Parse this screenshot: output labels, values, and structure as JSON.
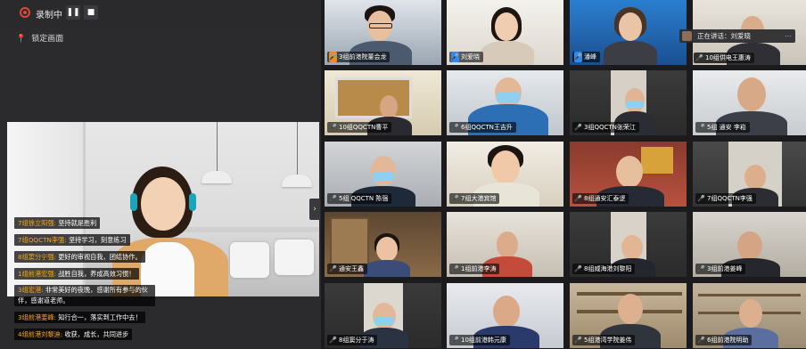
{
  "toolbar": {
    "recording_label": "录制中",
    "pause_icon": "pause-icon",
    "stop_icon": "stop-icon"
  },
  "lock_label": "锁定画面",
  "speaking_label": "正在讲话：刘爱晓",
  "chat_messages": [
    {
      "name": "7组徐立阳强:",
      "text": "坚持就是胜利"
    },
    {
      "name": "7组QQCTN李强:",
      "text": "坚持学习，刻意练习"
    },
    {
      "name": "8组窦分宁强:",
      "text": "更好的审视自我，团结协作。"
    },
    {
      "name": "1组前港宏强:",
      "text": "战胜自我，养成高效习惯！"
    },
    {
      "name": "3组宏港:",
      "text": "非常美好的夜晚，感谢所有参与的伙伴，感谢道老师。"
    },
    {
      "name": "3组前港姜峰:",
      "text": "知行合一，落实到工作中去！"
    },
    {
      "name": "4组前港刘黎迪:",
      "text": "收获，成长，共同进步"
    }
  ],
  "participants": [
    {
      "name": "3组前港院董会龙",
      "mic": "orange"
    },
    {
      "name": "刘爱晓",
      "mic": "blue"
    },
    {
      "name": "潘峰",
      "mic": "blue"
    },
    {
      "name": "10组供电王惠涛",
      "mic": "none"
    },
    {
      "name": "10组QQCTN曹平",
      "mic": "none"
    },
    {
      "name": "6组QQCTN王吉升",
      "mic": "none"
    },
    {
      "name": "3组QQCTN张荣江",
      "mic": "none"
    },
    {
      "name": "5组 通安 李崧",
      "mic": "none"
    },
    {
      "name": "5组 QQCTN 陈强",
      "mic": "none"
    },
    {
      "name": "7组大港宾馆",
      "mic": "none"
    },
    {
      "name": "8组通安汇泰逻",
      "mic": "none"
    },
    {
      "name": "7组QQCTN李强",
      "mic": "none"
    },
    {
      "name": "通安王鑫",
      "mic": "none"
    },
    {
      "name": "1组前港李涛",
      "mic": "none"
    },
    {
      "name": "8组威海港刘黎阳",
      "mic": "none"
    },
    {
      "name": "3组前港姜峰",
      "mic": "none"
    },
    {
      "name": "8组窦分于涛",
      "mic": "none"
    },
    {
      "name": "10组前港韩元康",
      "mic": "none"
    },
    {
      "name": "5组港湾学院姜伟",
      "mic": "none"
    },
    {
      "name": "6组前港院明助",
      "mic": "none"
    }
  ],
  "colors": {
    "accent_orange": "#f5a623",
    "mic_orange": "#f08a24",
    "mic_blue": "#2d8cf0",
    "recording_red": "#e0483e"
  }
}
